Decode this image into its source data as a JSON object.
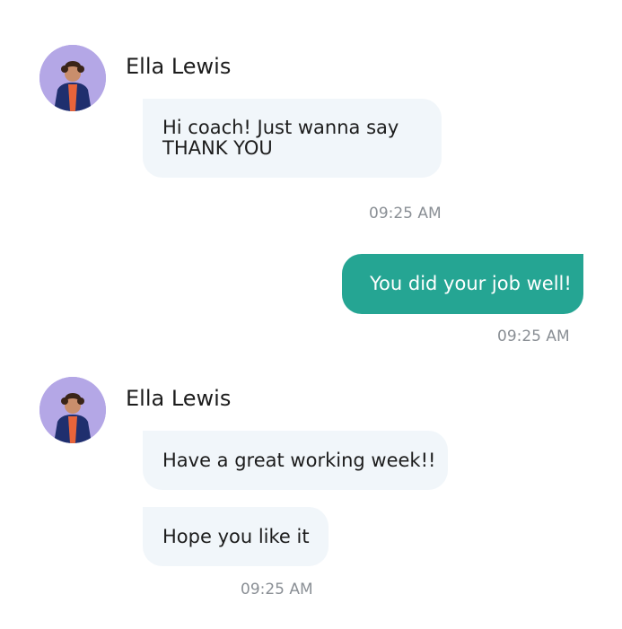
{
  "conversation": {
    "groups": [
      {
        "sender": "Ella Lewis",
        "messages": [
          "Hi coach! Just wanna say\nTHANK YOU"
        ],
        "time": "09:25 AM"
      },
      {
        "sender": "",
        "messages": [
          "You did your job well!"
        ],
        "time": "09:25 AM"
      },
      {
        "sender": "Ella Lewis",
        "messages": [
          "Have a great working week!!",
          "Hope you like it"
        ],
        "time": "09:25 AM"
      }
    ]
  },
  "colors": {
    "incoming_bubble": "#f1f6fa",
    "outgoing_bubble": "#25a593",
    "avatar_background": "#b4a7e6",
    "timestamp": "#8a8f95"
  },
  "icons": {
    "avatar": "user-avatar-icon"
  }
}
